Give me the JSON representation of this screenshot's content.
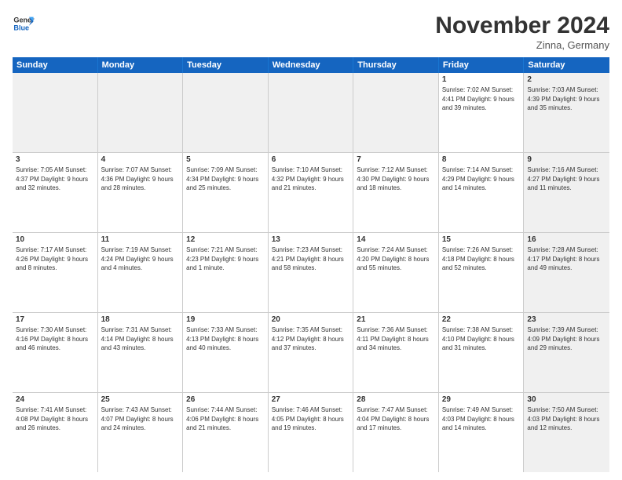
{
  "logo": {
    "general": "General",
    "blue": "Blue"
  },
  "title": "November 2024",
  "location": "Zinna, Germany",
  "headers": [
    "Sunday",
    "Monday",
    "Tuesday",
    "Wednesday",
    "Thursday",
    "Friday",
    "Saturday"
  ],
  "rows": [
    [
      {
        "day": "",
        "info": "",
        "shaded": true
      },
      {
        "day": "",
        "info": "",
        "shaded": true
      },
      {
        "day": "",
        "info": "",
        "shaded": true
      },
      {
        "day": "",
        "info": "",
        "shaded": true
      },
      {
        "day": "",
        "info": "",
        "shaded": true
      },
      {
        "day": "1",
        "info": "Sunrise: 7:02 AM\nSunset: 4:41 PM\nDaylight: 9 hours\nand 39 minutes.",
        "shaded": false
      },
      {
        "day": "2",
        "info": "Sunrise: 7:03 AM\nSunset: 4:39 PM\nDaylight: 9 hours\nand 35 minutes.",
        "shaded": true
      }
    ],
    [
      {
        "day": "3",
        "info": "Sunrise: 7:05 AM\nSunset: 4:37 PM\nDaylight: 9 hours\nand 32 minutes.",
        "shaded": false
      },
      {
        "day": "4",
        "info": "Sunrise: 7:07 AM\nSunset: 4:36 PM\nDaylight: 9 hours\nand 28 minutes.",
        "shaded": false
      },
      {
        "day": "5",
        "info": "Sunrise: 7:09 AM\nSunset: 4:34 PM\nDaylight: 9 hours\nand 25 minutes.",
        "shaded": false
      },
      {
        "day": "6",
        "info": "Sunrise: 7:10 AM\nSunset: 4:32 PM\nDaylight: 9 hours\nand 21 minutes.",
        "shaded": false
      },
      {
        "day": "7",
        "info": "Sunrise: 7:12 AM\nSunset: 4:30 PM\nDaylight: 9 hours\nand 18 minutes.",
        "shaded": false
      },
      {
        "day": "8",
        "info": "Sunrise: 7:14 AM\nSunset: 4:29 PM\nDaylight: 9 hours\nand 14 minutes.",
        "shaded": false
      },
      {
        "day": "9",
        "info": "Sunrise: 7:16 AM\nSunset: 4:27 PM\nDaylight: 9 hours\nand 11 minutes.",
        "shaded": true
      }
    ],
    [
      {
        "day": "10",
        "info": "Sunrise: 7:17 AM\nSunset: 4:26 PM\nDaylight: 9 hours\nand 8 minutes.",
        "shaded": false
      },
      {
        "day": "11",
        "info": "Sunrise: 7:19 AM\nSunset: 4:24 PM\nDaylight: 9 hours\nand 4 minutes.",
        "shaded": false
      },
      {
        "day": "12",
        "info": "Sunrise: 7:21 AM\nSunset: 4:23 PM\nDaylight: 9 hours\nand 1 minute.",
        "shaded": false
      },
      {
        "day": "13",
        "info": "Sunrise: 7:23 AM\nSunset: 4:21 PM\nDaylight: 8 hours\nand 58 minutes.",
        "shaded": false
      },
      {
        "day": "14",
        "info": "Sunrise: 7:24 AM\nSunset: 4:20 PM\nDaylight: 8 hours\nand 55 minutes.",
        "shaded": false
      },
      {
        "day": "15",
        "info": "Sunrise: 7:26 AM\nSunset: 4:18 PM\nDaylight: 8 hours\nand 52 minutes.",
        "shaded": false
      },
      {
        "day": "16",
        "info": "Sunrise: 7:28 AM\nSunset: 4:17 PM\nDaylight: 8 hours\nand 49 minutes.",
        "shaded": true
      }
    ],
    [
      {
        "day": "17",
        "info": "Sunrise: 7:30 AM\nSunset: 4:16 PM\nDaylight: 8 hours\nand 46 minutes.",
        "shaded": false
      },
      {
        "day": "18",
        "info": "Sunrise: 7:31 AM\nSunset: 4:14 PM\nDaylight: 8 hours\nand 43 minutes.",
        "shaded": false
      },
      {
        "day": "19",
        "info": "Sunrise: 7:33 AM\nSunset: 4:13 PM\nDaylight: 8 hours\nand 40 minutes.",
        "shaded": false
      },
      {
        "day": "20",
        "info": "Sunrise: 7:35 AM\nSunset: 4:12 PM\nDaylight: 8 hours\nand 37 minutes.",
        "shaded": false
      },
      {
        "day": "21",
        "info": "Sunrise: 7:36 AM\nSunset: 4:11 PM\nDaylight: 8 hours\nand 34 minutes.",
        "shaded": false
      },
      {
        "day": "22",
        "info": "Sunrise: 7:38 AM\nSunset: 4:10 PM\nDaylight: 8 hours\nand 31 minutes.",
        "shaded": false
      },
      {
        "day": "23",
        "info": "Sunrise: 7:39 AM\nSunset: 4:09 PM\nDaylight: 8 hours\nand 29 minutes.",
        "shaded": true
      }
    ],
    [
      {
        "day": "24",
        "info": "Sunrise: 7:41 AM\nSunset: 4:08 PM\nDaylight: 8 hours\nand 26 minutes.",
        "shaded": false
      },
      {
        "day": "25",
        "info": "Sunrise: 7:43 AM\nSunset: 4:07 PM\nDaylight: 8 hours\nand 24 minutes.",
        "shaded": false
      },
      {
        "day": "26",
        "info": "Sunrise: 7:44 AM\nSunset: 4:06 PM\nDaylight: 8 hours\nand 21 minutes.",
        "shaded": false
      },
      {
        "day": "27",
        "info": "Sunrise: 7:46 AM\nSunset: 4:05 PM\nDaylight: 8 hours\nand 19 minutes.",
        "shaded": false
      },
      {
        "day": "28",
        "info": "Sunrise: 7:47 AM\nSunset: 4:04 PM\nDaylight: 8 hours\nand 17 minutes.",
        "shaded": false
      },
      {
        "day": "29",
        "info": "Sunrise: 7:49 AM\nSunset: 4:03 PM\nDaylight: 8 hours\nand 14 minutes.",
        "shaded": false
      },
      {
        "day": "30",
        "info": "Sunrise: 7:50 AM\nSunset: 4:03 PM\nDaylight: 8 hours\nand 12 minutes.",
        "shaded": true
      }
    ]
  ]
}
